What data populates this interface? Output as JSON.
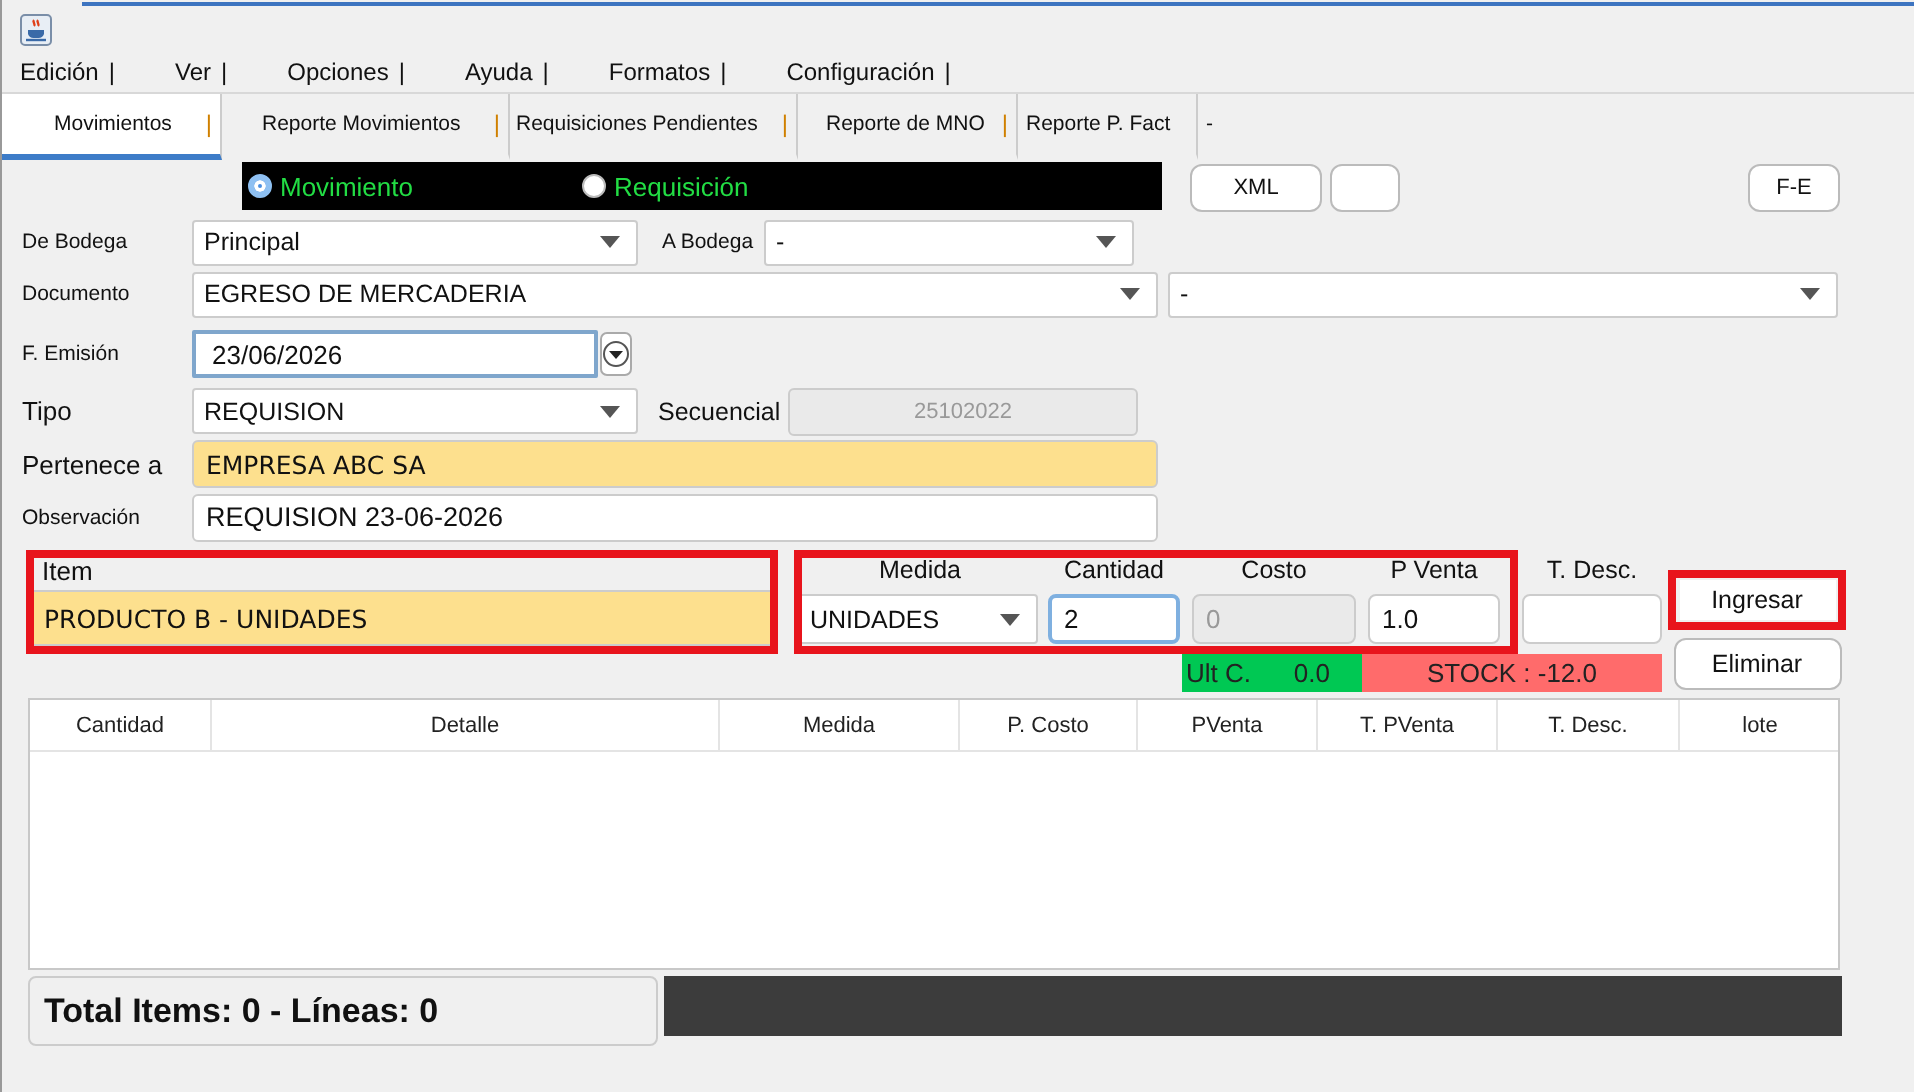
{
  "menu": [
    {
      "label": "Edición",
      "separator": "|"
    },
    {
      "label": "Ver",
      "separator": "|"
    },
    {
      "label": "Opciones",
      "separator": "|"
    },
    {
      "label": "Ayuda",
      "separator": "|"
    },
    {
      "label": "Formatos",
      "separator": "|"
    },
    {
      "label": "Configuración",
      "separator": "|"
    }
  ],
  "tabs": [
    {
      "label": "Movimientos",
      "separator": "|",
      "selected": true
    },
    {
      "label": "Reporte Movimientos",
      "separator": "|",
      "selected": false
    },
    {
      "label": "Requisiciones Pendientes",
      "separator": "|",
      "selected": false
    },
    {
      "label": "Reporte de MNO",
      "separator": "|",
      "selected": false
    },
    {
      "label": "Reporte P. Fact",
      "selected": false
    },
    {
      "label": "-",
      "selected": false
    }
  ],
  "mode_options": [
    {
      "label": "Movimiento",
      "selected": true
    },
    {
      "label": "Requisición",
      "selected": false
    }
  ],
  "buttons": {
    "xml": "XML",
    "fe": "F-E"
  },
  "de_bodega": {
    "label": "De Bodega",
    "value": "Principal"
  },
  "a_bodega": {
    "label": "A Bodega",
    "value": "-"
  },
  "documento": {
    "label": "Documento",
    "value": "EGRESO DE MERCADERIA"
  },
  "documento_extra": {
    "value": "-"
  },
  "f_emision": {
    "label": "F. Emisión",
    "value": "23/06/2026"
  },
  "tipo": {
    "label": "Tipo",
    "value": "REQUISION"
  },
  "secuencial": {
    "label": "Secuencial",
    "value": "25102022",
    "disabled": true
  },
  "pertenece_a": {
    "label": "Pertenece a",
    "value": "EMPRESA ABC SA"
  },
  "observacion": {
    "label": "Observación",
    "value": "REQUISION 23-06-2026"
  },
  "item": {
    "label": "Item",
    "value": "PRODUCTO B - UNIDADES",
    "highlighted": true
  },
  "line_fields_highlighted": true,
  "line_fields": [
    {
      "label": "Medida",
      "kind": "select",
      "value": "UNIDADES",
      "disabled": false,
      "focused": false
    },
    {
      "label": "Cantidad",
      "kind": "input",
      "value": "2",
      "disabled": false,
      "focused": true
    },
    {
      "label": "Costo",
      "kind": "input",
      "value": "0",
      "disabled": true,
      "focused": false
    },
    {
      "label": "P Venta",
      "kind": "input",
      "value": "1.0",
      "disabled": false,
      "focused": false
    },
    {
      "label": "T. Desc.",
      "kind": "input",
      "disabled": false,
      "focused": false
    }
  ],
  "actions": [
    {
      "label": "Ingresar",
      "highlighted": true
    },
    {
      "label": "Eliminar",
      "highlighted": false
    }
  ],
  "ult_c": {
    "label": "Ult C.",
    "value": "0.0"
  },
  "stock": "STOCK : -12.0",
  "table": {
    "columns": [
      "Cantidad",
      "Detalle",
      "Medida",
      "P. Costo",
      "PVenta",
      "T. PVenta",
      "T. Desc.",
      "lote"
    ]
  },
  "totals": "Total Items: 0 - Líneas: 0"
}
